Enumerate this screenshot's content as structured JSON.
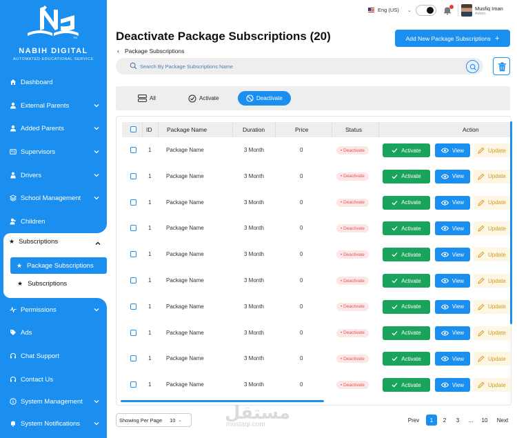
{
  "brand": {
    "name": "NABIH DIGITAL",
    "tagline": "AUTOMATED EDUCATIONAL SERVICE",
    "tm": "TM"
  },
  "topbar": {
    "language": "Eng (US)",
    "user_name": "Musfiq Iman",
    "user_role": "Admin"
  },
  "sidebar": {
    "items": [
      {
        "label": "Dashboard",
        "icon": "home-icon",
        "chevron": false
      },
      {
        "label": "External Parents",
        "icon": "user-icon",
        "chevron": true
      },
      {
        "label": "Added Parents",
        "icon": "user-icon",
        "chevron": true
      },
      {
        "label": "Supervisors",
        "icon": "id-card-icon",
        "chevron": true
      },
      {
        "label": "Drivers",
        "icon": "driver-icon",
        "chevron": true
      },
      {
        "label": "School Management",
        "icon": "layers-icon",
        "chevron": true
      },
      {
        "label": "Children",
        "icon": "child-icon",
        "chevron": true
      }
    ],
    "subscriptions": {
      "label": "Subscriptions",
      "children": [
        "Package Subscriptions",
        "Subscriptions"
      ]
    },
    "items_after": [
      {
        "label": "Permissions",
        "icon": "pulse-icon",
        "chevron": true
      },
      {
        "label": "Ads",
        "icon": "tag-icon",
        "chevron": false
      },
      {
        "label": "Chat Support",
        "icon": "headset-icon",
        "chevron": false
      },
      {
        "label": "Contact Us",
        "icon": "headset-icon",
        "chevron": false
      },
      {
        "label": "System Management",
        "icon": "info-icon",
        "chevron": true
      },
      {
        "label": "System Notifications",
        "icon": "bell-icon",
        "chevron": true
      }
    ]
  },
  "header": {
    "title": "Deactivate Package Subscriptions (20)",
    "breadcrumb": "Package Subscriptions",
    "add_button": "Add New Package Subscriptions"
  },
  "search": {
    "placeholder": "Search By Package Subscriptions Name"
  },
  "filters": [
    {
      "label": "All",
      "active": false
    },
    {
      "label": "Activate",
      "active": false
    },
    {
      "label": "Deactivate",
      "active": true
    }
  ],
  "table": {
    "headers": [
      "ID",
      "Package  Name",
      "Duration",
      "Price",
      "Status",
      "Action"
    ],
    "rows": [
      {
        "id": "1",
        "name": "Package  Name",
        "duration": "3 Month",
        "price": "0",
        "status": "Deactivate"
      },
      {
        "id": "1",
        "name": "Package  Name",
        "duration": "3 Month",
        "price": "0",
        "status": "Deactivate"
      },
      {
        "id": "1",
        "name": "Package  Name",
        "duration": "3 Month",
        "price": "0",
        "status": "Deactivate"
      },
      {
        "id": "1",
        "name": "Package  Name",
        "duration": "3 Month",
        "price": "0",
        "status": "Deactivate"
      },
      {
        "id": "1",
        "name": "Package  Name",
        "duration": "3 Month",
        "price": "0",
        "status": "Deactivate"
      },
      {
        "id": "1",
        "name": "Package  Name",
        "duration": "3 Month",
        "price": "0",
        "status": "Deactivate"
      },
      {
        "id": "1",
        "name": "Package  Name",
        "duration": "3 Month",
        "price": "0",
        "status": "Deactivate"
      },
      {
        "id": "1",
        "name": "Package  Name",
        "duration": "3 Month",
        "price": "0",
        "status": "Deactivate"
      },
      {
        "id": "1",
        "name": "Package  Name",
        "duration": "3 Month",
        "price": "0",
        "status": "Deactivate"
      },
      {
        "id": "1",
        "name": "Package  Name",
        "duration": "3 Month",
        "price": "0",
        "status": "Deactivate"
      }
    ],
    "actions": {
      "activate": "Activate",
      "view": "View",
      "update": "Update"
    }
  },
  "footer": {
    "per_page_label": "Showing Per Page",
    "per_page_value": "10",
    "prev": "Prev",
    "next": "Next",
    "pages": [
      "1",
      "2",
      "3",
      "...",
      "10"
    ],
    "current_page": "1"
  },
  "watermark": {
    "arabic": "مستقل",
    "latin": "mostaqi.com"
  },
  "colors": {
    "primary": "#1b8ff0",
    "success": "#1aa35a",
    "danger": "#e05555",
    "warning": "#d19a1e"
  }
}
